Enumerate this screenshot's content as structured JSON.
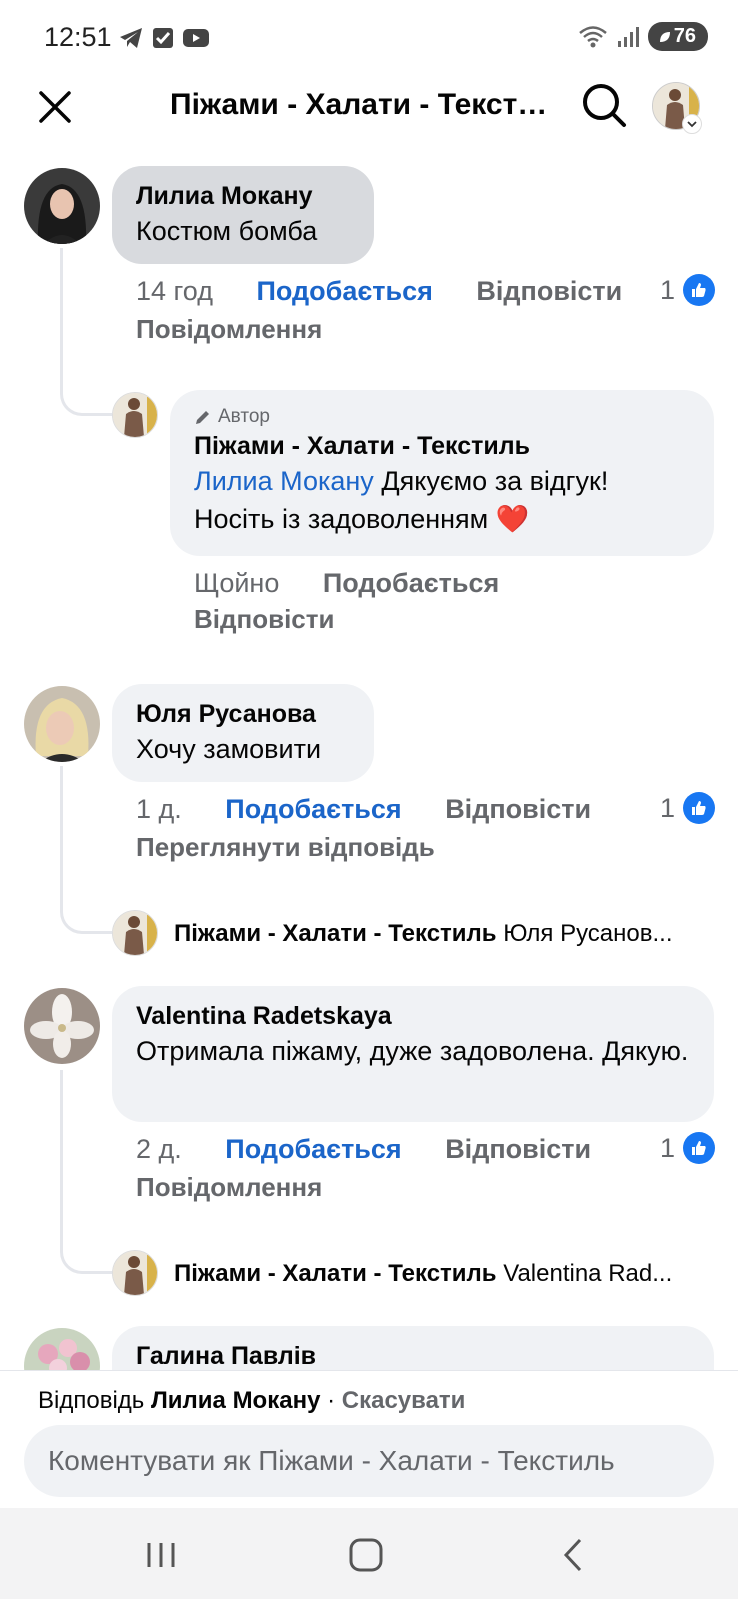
{
  "status_bar": {
    "time": "12:51",
    "battery": "76"
  },
  "header": {
    "title": "Піжами - Халати - Текстиль",
    "close_icon": "close-icon",
    "search_icon": "search-icon"
  },
  "comments": [
    {
      "author": "Лилиа Мокану",
      "text": "Костюм бомба",
      "time": "14 год",
      "like_label": "Подобається",
      "reply_label": "Відповісти",
      "like_count": "1",
      "extra_link": "Повідомлення",
      "reply": {
        "badge": "Автор",
        "author": "Піжами - Халати - Текстиль",
        "mention": "Лилиа Мокану",
        "text": " Дякуємо за відгук! Носіть із задоволенням ❤️",
        "time": "Щойно",
        "like_label": "Подобається",
        "reply_label": "Відповісти"
      }
    },
    {
      "author": "Юля Русанова",
      "text": "Хочу замовити",
      "time": "1 д.",
      "like_label": "Подобається",
      "reply_label": "Відповісти",
      "like_count": "1",
      "extra_link": "Переглянути відповідь",
      "collapsed_reply": {
        "author": "Піжами - Халати - Текстиль",
        "preview": "Юля Русанов..."
      }
    },
    {
      "author": "Valentina Radetskaya",
      "text": "Отримала піжаму, дуже задоволена. Дякую.",
      "time": "2 д.",
      "like_label": "Подобається",
      "reply_label": "Відповісти",
      "like_count": "1",
      "extra_link": "Повідомлення",
      "collapsed_reply": {
        "author": "Піжами - Халати - Текстиль",
        "preview": "Valentina Rad..."
      }
    },
    {
      "author": "Галина Павлів"
    }
  ],
  "footer": {
    "reply_prefix": "Відповідь ",
    "reply_to": "Лилиа Мокану",
    "separator": " · ",
    "cancel": "Скасувати",
    "input_placeholder": "Коментувати як Піжами - Халати - Текстиль"
  },
  "colors": {
    "accent": "#1b65c9",
    "like_badge": "#1877f2",
    "bubble": "#f0f2f5",
    "muted": "#65676b"
  }
}
